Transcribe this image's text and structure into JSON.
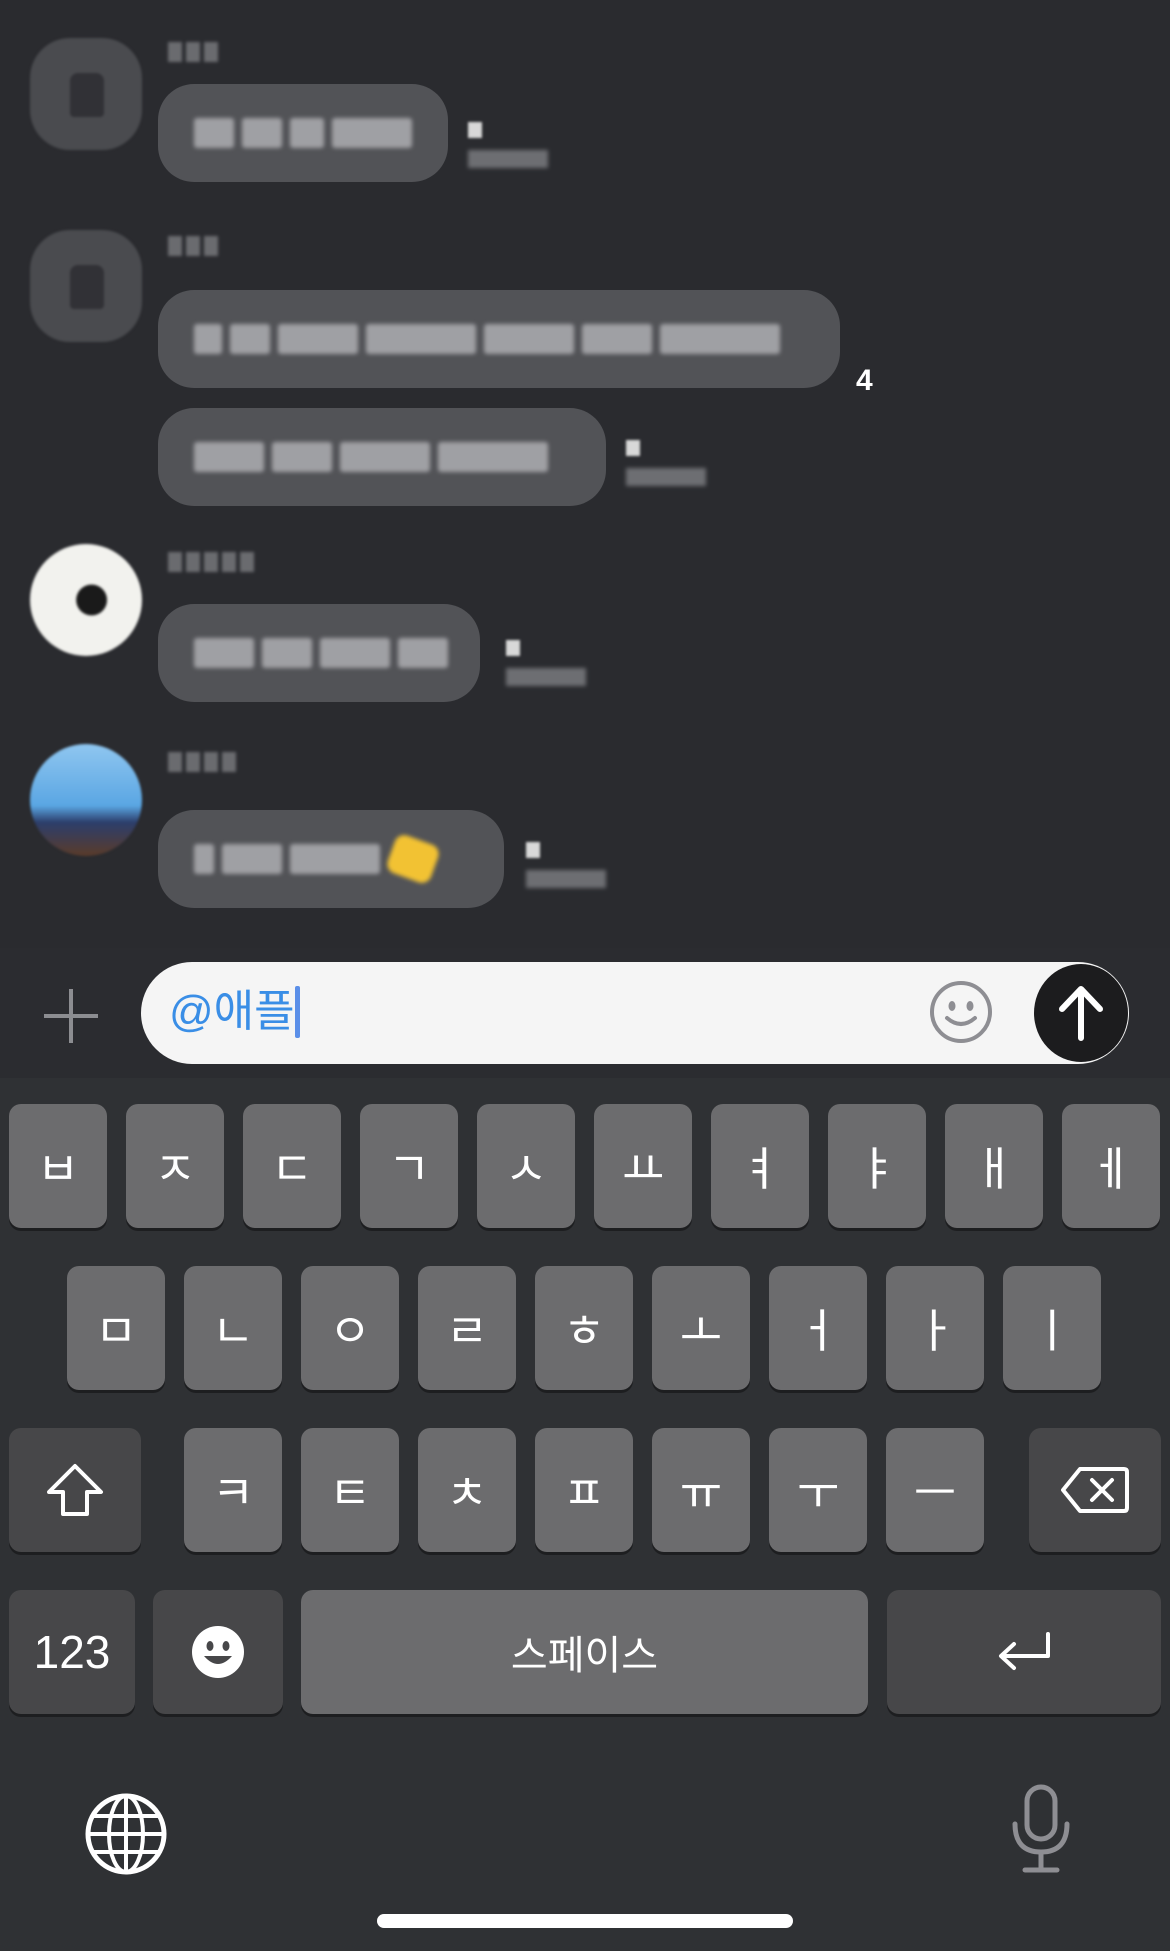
{
  "chat": {
    "messages": [
      {
        "avatar": "person-silhouette-avatar",
        "bubble_text_blurred": true,
        "unread": "",
        "time": ""
      },
      {
        "avatar": "person-silhouette-avatar",
        "bubble_text_blurred": true,
        "count": "4",
        "second_bubble": true
      },
      {
        "avatar": "photo-avatar-white",
        "bubble_text_blurred": true
      },
      {
        "avatar": "photo-avatar-blue",
        "bubble_text_blurred": true,
        "has_emoji": true
      }
    ],
    "read_count": "4"
  },
  "input": {
    "add_icon": "plus-icon",
    "value": "@애플",
    "emoji_icon": "smiley-icon",
    "send_icon": "arrow-up-icon"
  },
  "keyboard": {
    "row1": [
      "ㅂ",
      "ㅈ",
      "ㄷ",
      "ㄱ",
      "ㅅ",
      "ㅛ",
      "ㅕ",
      "ㅑ",
      "ㅐ",
      "ㅔ"
    ],
    "row2": [
      "ㅁ",
      "ㄴ",
      "ㅇ",
      "ㄹ",
      "ㅎ",
      "ㅗ",
      "ㅓ",
      "ㅏ",
      "ㅣ"
    ],
    "row3": [
      "ㅋ",
      "ㅌ",
      "ㅊ",
      "ㅍ",
      "ㅠ",
      "ㅜ",
      "ㅡ"
    ],
    "shift_icon": "shift-arrow-icon",
    "delete_icon": "backspace-icon",
    "numbers_label": "123",
    "emoji_key_icon": "emoji-face-icon",
    "space_label": "스페이스",
    "return_icon": "return-arrow-icon",
    "globe_icon": "globe-icon",
    "mic_icon": "microphone-icon"
  },
  "colors": {
    "chat_bg": "#2a2b2f",
    "bubble": "#525357",
    "input_text": "#3a8ee6",
    "key_light": "#6c6c6e",
    "key_dark": "#474749",
    "keyboard_bg": "#2f3134"
  }
}
